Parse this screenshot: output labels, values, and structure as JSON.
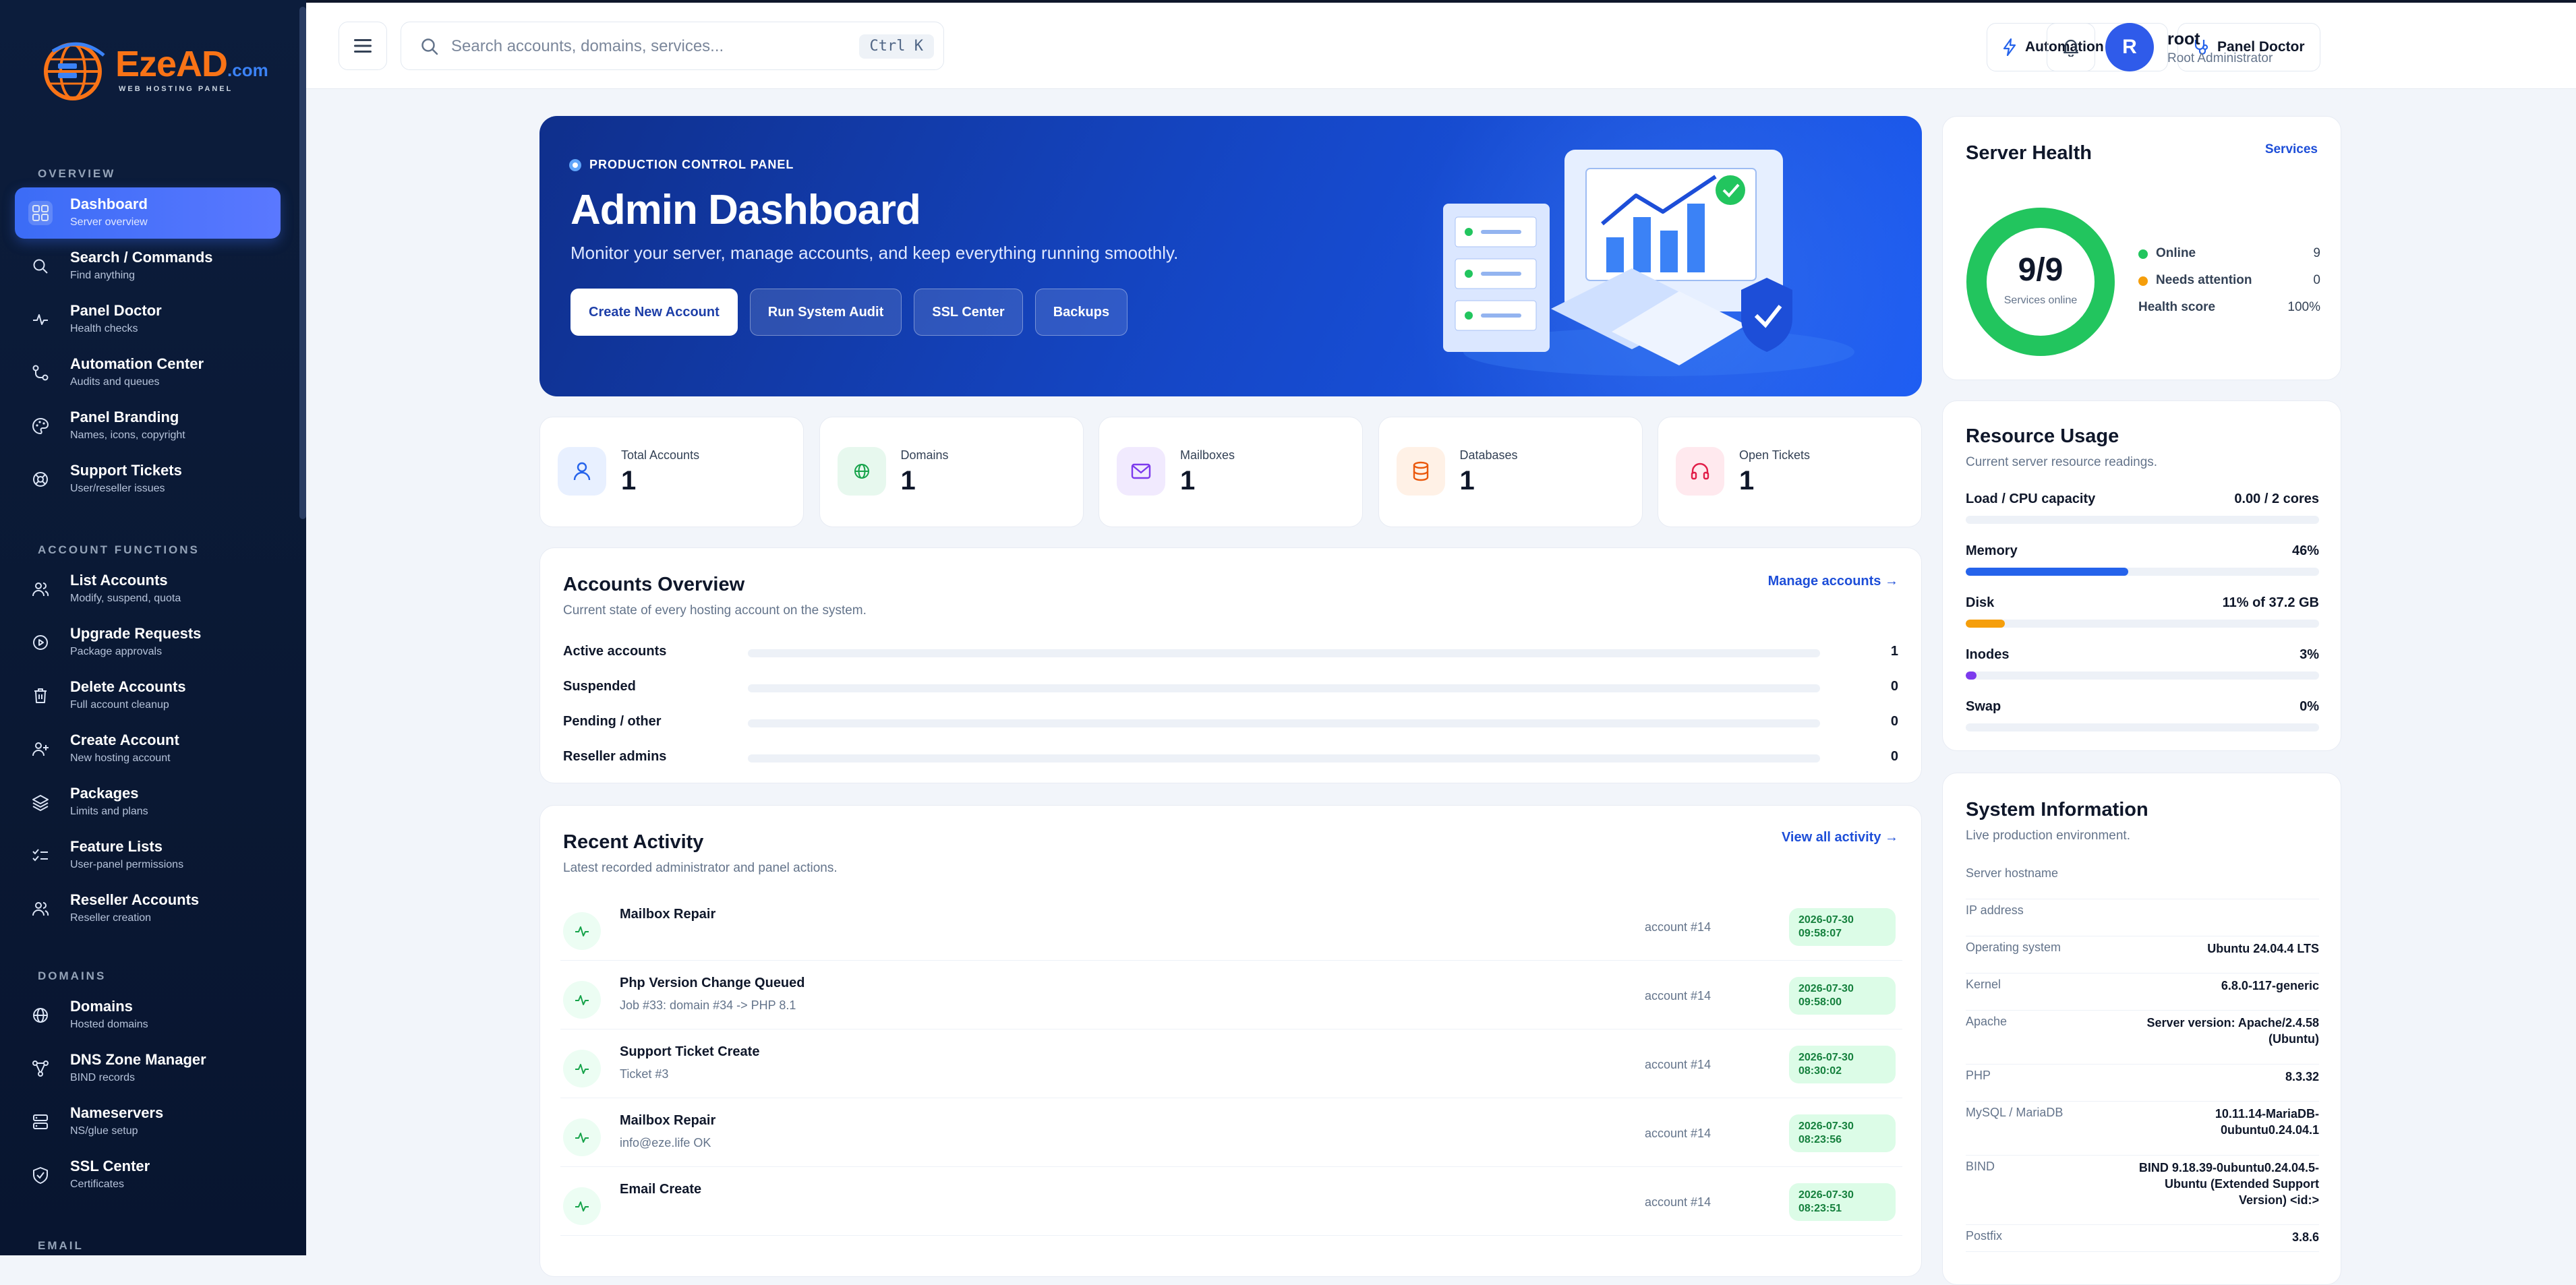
{
  "brand": {
    "name": "EzeAD",
    "tld": ".com",
    "tagline": "WEB HOSTING PANEL"
  },
  "sidebar": {
    "sections": [
      {
        "title": "OVERVIEW",
        "items": [
          {
            "label": "Dashboard",
            "sub": "Server overview",
            "icon": "grid-icon",
            "active": true
          },
          {
            "label": "Search / Commands",
            "sub": "Find anything",
            "icon": "search-icon"
          },
          {
            "label": "Panel Doctor",
            "sub": "Health checks",
            "icon": "pulse-icon"
          },
          {
            "label": "Automation Center",
            "sub": "Audits and queues",
            "icon": "workflow-icon"
          },
          {
            "label": "Panel Branding",
            "sub": "Names, icons, copyright",
            "icon": "palette-icon"
          },
          {
            "label": "Support Tickets",
            "sub": "User/reseller issues",
            "icon": "lifebuoy-icon"
          }
        ]
      },
      {
        "title": "ACCOUNT FUNCTIONS",
        "items": [
          {
            "label": "List Accounts",
            "sub": "Modify, suspend, quota",
            "icon": "users-icon"
          },
          {
            "label": "Upgrade Requests",
            "sub": "Package approvals",
            "icon": "play-circle-icon"
          },
          {
            "label": "Delete Accounts",
            "sub": "Full account cleanup",
            "icon": "trash-icon"
          },
          {
            "label": "Create Account",
            "sub": "New hosting account",
            "icon": "user-plus-icon"
          },
          {
            "label": "Packages",
            "sub": "Limits and plans",
            "icon": "layers-icon"
          },
          {
            "label": "Feature Lists",
            "sub": "User-panel permissions",
            "icon": "list-check-icon"
          },
          {
            "label": "Reseller Accounts",
            "sub": "Reseller creation",
            "icon": "users-icon"
          }
        ]
      },
      {
        "title": "DOMAINS",
        "items": [
          {
            "label": "Domains",
            "sub": "Hosted domains",
            "icon": "globe-icon"
          },
          {
            "label": "DNS Zone Manager",
            "sub": "BIND records",
            "icon": "network-icon"
          },
          {
            "label": "Nameservers",
            "sub": "NS/glue setup",
            "icon": "server-icon"
          },
          {
            "label": "SSL Center",
            "sub": "Certificates",
            "icon": "shield-check-icon"
          }
        ]
      },
      {
        "title": "EMAIL",
        "items": []
      }
    ]
  },
  "topbar": {
    "search_placeholder": "Search accounts, domains, services...",
    "search_shortcut": "Ctrl K",
    "automation_label": "Automation Center",
    "doctor_label": "Panel Doctor",
    "user": {
      "initial": "R",
      "name": "root",
      "role": "Root Administrator"
    }
  },
  "hero": {
    "eyebrow": "PRODUCTION CONTROL PANEL",
    "title": "Admin Dashboard",
    "subtitle": "Monitor your server, manage accounts, and keep everything running smoothly.",
    "buttons": [
      "Create New Account",
      "Run System Audit",
      "SSL Center",
      "Backups"
    ]
  },
  "stats": [
    {
      "label": "Total Accounts",
      "value": "1",
      "icon": "user-icon",
      "color": "#2563eb",
      "bg": "#e8f0ff"
    },
    {
      "label": "Domains",
      "value": "1",
      "icon": "globe-icon",
      "color": "#16a34a",
      "bg": "#e7f8ee"
    },
    {
      "label": "Mailboxes",
      "value": "1",
      "icon": "mail-icon",
      "color": "#7c3aed",
      "bg": "#f1eafe"
    },
    {
      "label": "Databases",
      "value": "1",
      "icon": "database-icon",
      "color": "#ea580c",
      "bg": "#fff1e6"
    },
    {
      "label": "Open Tickets",
      "value": "1",
      "icon": "headset-icon",
      "color": "#e11d48",
      "bg": "#ffe9ee"
    }
  ],
  "accounts_overview": {
    "title": "Accounts Overview",
    "subtitle": "Current state of every hosting account on the system.",
    "link": "Manage accounts →",
    "rows": [
      {
        "label": "Active accounts",
        "value": "1",
        "fraction": 0
      },
      {
        "label": "Suspended",
        "value": "0",
        "fraction": 0
      },
      {
        "label": "Pending / other",
        "value": "0",
        "fraction": 0
      },
      {
        "label": "Reseller admins",
        "value": "0",
        "fraction": 0
      }
    ]
  },
  "recent_activity": {
    "title": "Recent Activity",
    "subtitle": "Latest recorded administrator and panel actions.",
    "link": "View all activity →",
    "rows": [
      {
        "title": "Mailbox Repair",
        "detail": "",
        "account": "account #14",
        "date": "2026-07-30",
        "time": "09:58:07"
      },
      {
        "title": "Php Version Change Queued",
        "detail": "Job #33: domain #34 -> PHP 8.1",
        "account": "account #14",
        "date": "2026-07-30",
        "time": "09:58:00"
      },
      {
        "title": "Support Ticket Create",
        "detail": "Ticket #3",
        "account": "account #14",
        "date": "2026-07-30",
        "time": "08:30:02"
      },
      {
        "title": "Mailbox Repair",
        "detail": "info@eze.life OK",
        "account": "account #14",
        "date": "2026-07-30",
        "time": "08:23:56"
      },
      {
        "title": "Email Create",
        "detail": "",
        "account": "account #14",
        "date": "2026-07-30",
        "time": "08:23:51"
      }
    ]
  },
  "server_health": {
    "title": "Server Health",
    "link": "Services",
    "ratio": "9/9",
    "ring_caption": "Services online",
    "online_fraction": 1.0,
    "legend": [
      {
        "label": "Online",
        "value": "9",
        "color": "#22c55e"
      },
      {
        "label": "Needs attention",
        "value": "0",
        "color": "#f59e0b"
      },
      {
        "label": "Health score",
        "value": "100%",
        "color": ""
      }
    ]
  },
  "resource_usage": {
    "title": "Resource Usage",
    "subtitle": "Current server resource readings.",
    "rows": [
      {
        "label": "Load / CPU capacity",
        "value": "0.00 / 2 cores",
        "fraction": 0,
        "color": "#2563eb"
      },
      {
        "label": "Memory",
        "value": "46%",
        "fraction": 0.46,
        "color": "#2563eb"
      },
      {
        "label": "Disk",
        "value": "11% of 37.2 GB",
        "fraction": 0.11,
        "color": "#f59e0b"
      },
      {
        "label": "Inodes",
        "value": "3%",
        "fraction": 0.03,
        "color": "#7c3aed"
      },
      {
        "label": "Swap",
        "value": "0%",
        "fraction": 0,
        "color": "#2563eb"
      }
    ]
  },
  "system_info": {
    "title": "System Information",
    "subtitle": "Live production environment.",
    "rows": [
      {
        "key": "Server hostname",
        "value": ""
      },
      {
        "key": "IP address",
        "value": ""
      },
      {
        "key": "Operating system",
        "value": "Ubuntu 24.04.4 LTS"
      },
      {
        "key": "Kernel",
        "value": "6.8.0-117-generic"
      },
      {
        "key": "Apache",
        "value": "Server version: Apache/2.4.58 (Ubuntu)"
      },
      {
        "key": "PHP",
        "value": "8.3.32"
      },
      {
        "key": "MySQL / MariaDB",
        "value": "10.11.14-MariaDB-0ubuntu0.24.04.1"
      },
      {
        "key": "BIND",
        "value": "BIND 9.18.39-0ubuntu0.24.04.5-Ubuntu (Extended Support Version) <id:>"
      },
      {
        "key": "Postfix",
        "value": "3.8.6"
      }
    ]
  }
}
